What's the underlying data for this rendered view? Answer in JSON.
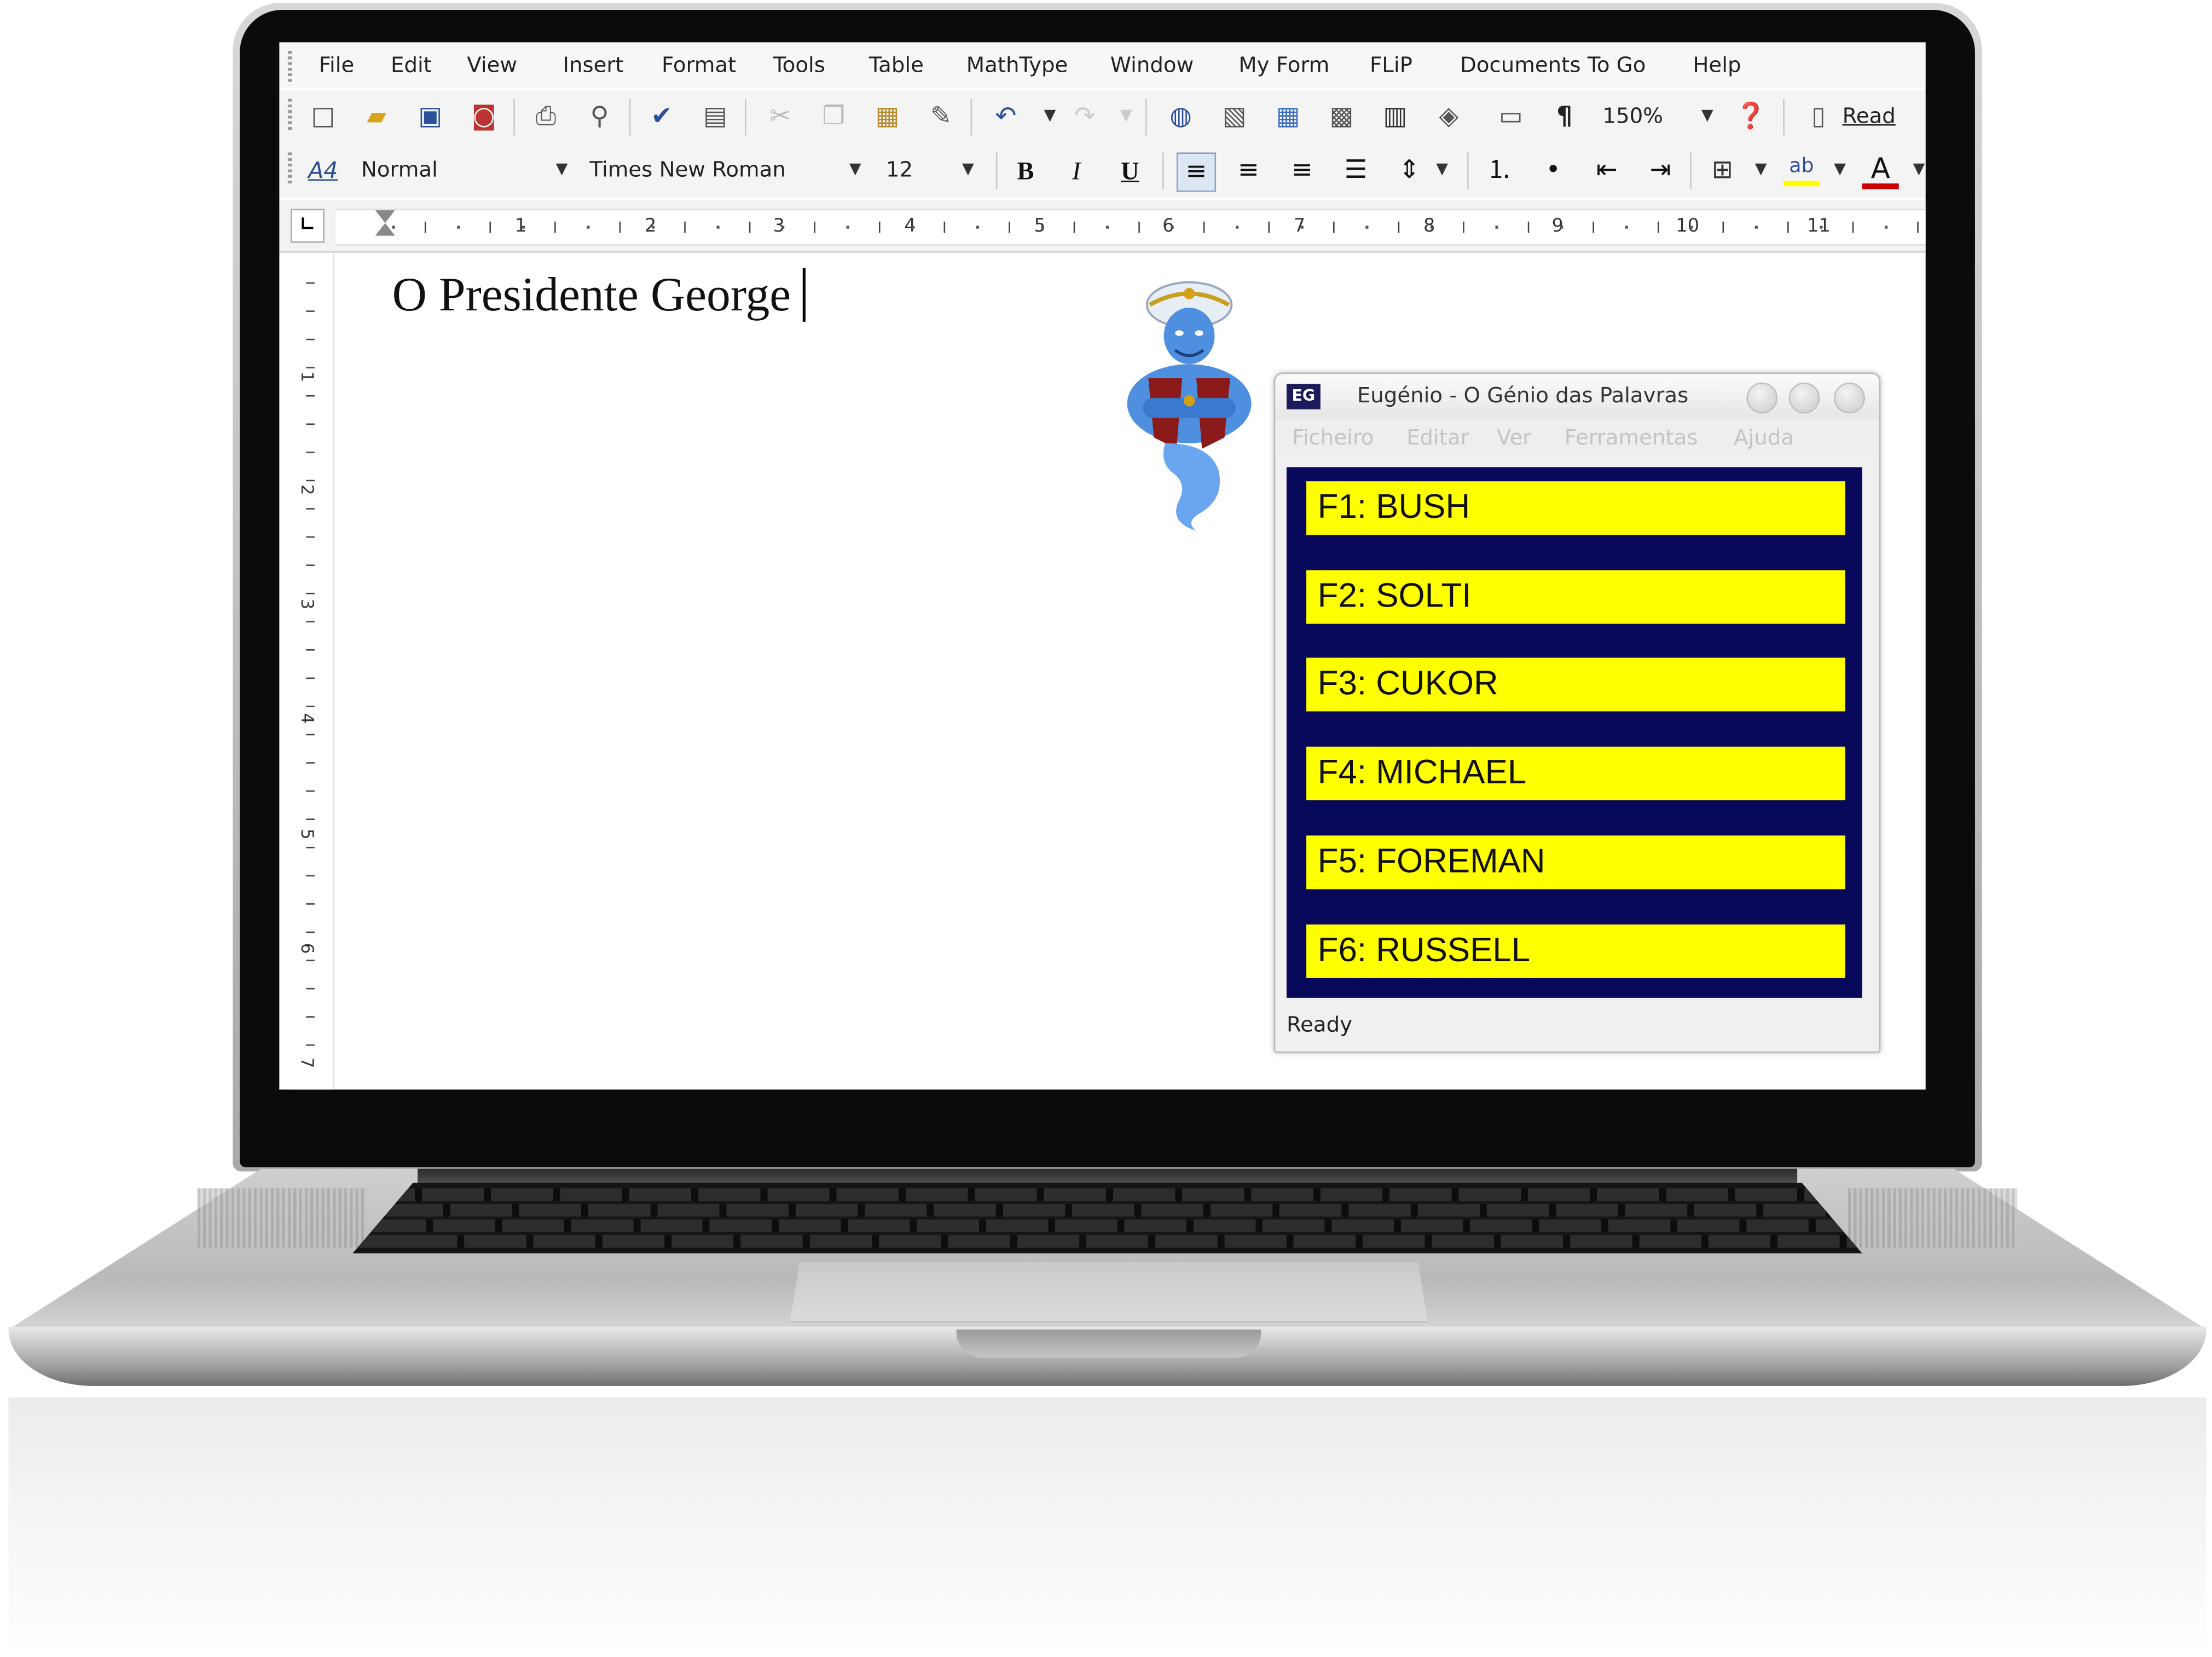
{
  "menubar": {
    "items": [
      "File",
      "Edit",
      "View",
      "Insert",
      "Format",
      "Tools",
      "Table",
      "MathType",
      "Window",
      "My Form",
      "FLiP",
      "Documents To Go",
      "Help"
    ]
  },
  "toolbar": {
    "zoom_value": "150%",
    "read_label": "Read",
    "paragraph_mark": "¶"
  },
  "format_bar": {
    "style_icon_label": "A4",
    "style_value": "Normal",
    "font_value": "Times New Roman",
    "size_value": "12",
    "bold_label": "B",
    "italic_label": "I",
    "underline_label": "U",
    "highlight_label": "ab",
    "font_color_label": "A",
    "font_color": "#cc0000",
    "highlight_color": "#ffff00"
  },
  "ruler": {
    "horizontal_numbers": [
      "1",
      "2",
      "3",
      "4",
      "5",
      "6",
      "7",
      "8",
      "9",
      "10",
      "11"
    ],
    "vertical_numbers": [
      "1",
      "2",
      "3",
      "4",
      "5",
      "6",
      "7"
    ]
  },
  "document": {
    "text": "O Presidente George"
  },
  "popup": {
    "logo": "EG",
    "title": "Eugénio - O Génio das Palavras",
    "menu": [
      "Ficheiro",
      "Editar",
      "Ver",
      "Ferramentas",
      "Ajuda"
    ],
    "suggestions": [
      "F1: BUSH",
      "F2: SOLTI",
      "F3: CUKOR",
      "F4: MICHAEL",
      "F5: FOREMAN",
      "F6: RUSSELL"
    ],
    "status": "Ready",
    "suggestion_bg": "#ffff00",
    "panel_bg": "#08085a"
  }
}
